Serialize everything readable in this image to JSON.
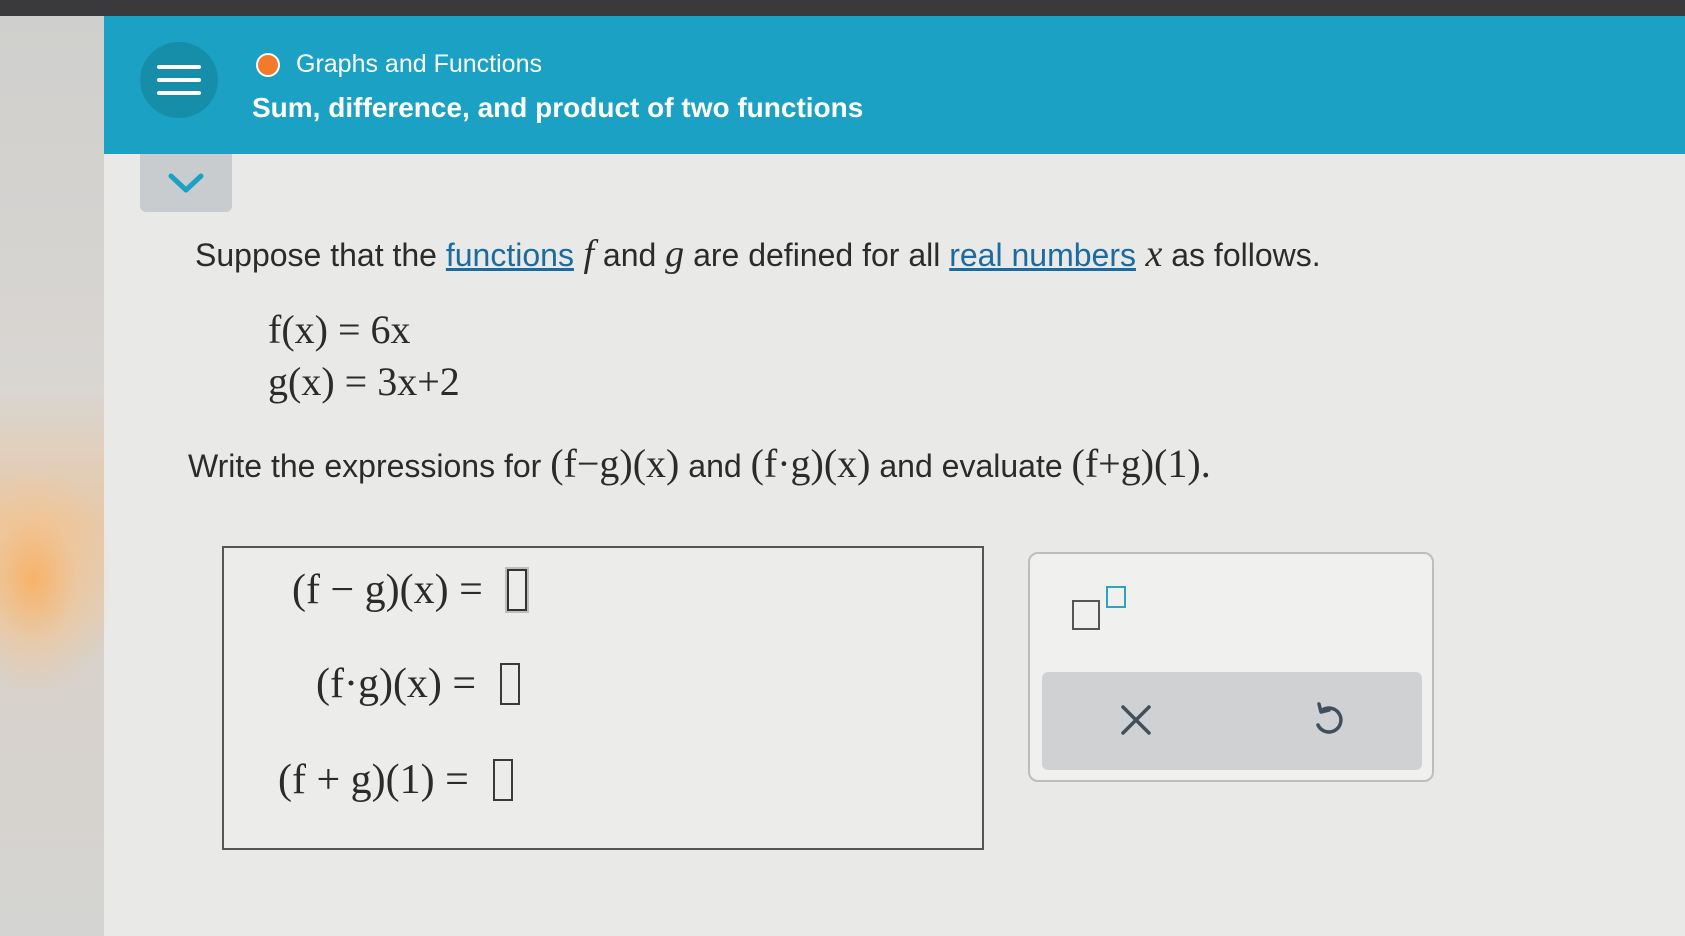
{
  "header": {
    "topic": "Graphs and Functions",
    "subtopic": "Sum, difference, and product of two functions",
    "status_color": "#f47a2b",
    "accent_color": "#1aa1c3"
  },
  "prompt": {
    "intro_1": "Suppose that the ",
    "link_functions": "functions",
    "intro_2": " and ",
    "intro_3": " are defined for all ",
    "link_real_numbers": "real numbers",
    "intro_4": " as follows.",
    "var_f": "f",
    "var_g": "g",
    "var_x": "x",
    "def_f": "f(x) = 6x",
    "def_g": "g(x) = 3x+2",
    "task_1": "Write the expressions for ",
    "task_expr_1": "(f−g)(x)",
    "task_2": " and ",
    "task_expr_2": "(f·g)(x)",
    "task_3": " and evaluate ",
    "task_expr_3": "(f+g)(1)",
    "task_end": "."
  },
  "answers": [
    {
      "label": "(f − g)(x) =",
      "value": ""
    },
    {
      "label": "(f·g)(x) =",
      "value": ""
    },
    {
      "label": "(f + g)(1) =",
      "value": ""
    }
  ],
  "tools": {
    "exponent_icon": "superscript-box-icon",
    "clear_icon": "x-icon",
    "undo_icon": "undo-icon"
  }
}
